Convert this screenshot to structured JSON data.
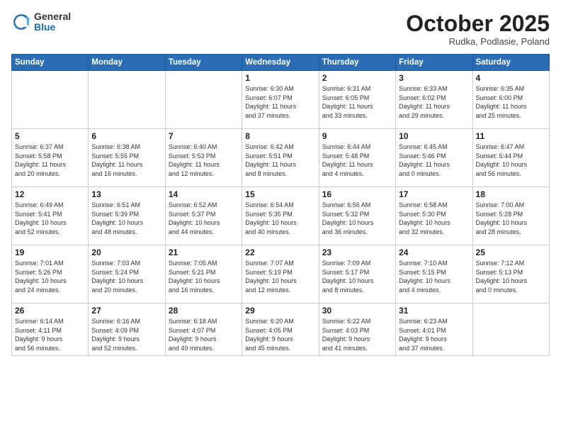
{
  "header": {
    "logo": {
      "general": "General",
      "blue": "Blue"
    },
    "title": "October 2025",
    "subtitle": "Rudka, Podlasie, Poland"
  },
  "weekdays": [
    "Sunday",
    "Monday",
    "Tuesday",
    "Wednesday",
    "Thursday",
    "Friday",
    "Saturday"
  ],
  "weeks": [
    [
      {
        "day": "",
        "info": ""
      },
      {
        "day": "",
        "info": ""
      },
      {
        "day": "",
        "info": ""
      },
      {
        "day": "1",
        "info": "Sunrise: 6:30 AM\nSunset: 6:07 PM\nDaylight: 11 hours\nand 37 minutes."
      },
      {
        "day": "2",
        "info": "Sunrise: 6:31 AM\nSunset: 6:05 PM\nDaylight: 11 hours\nand 33 minutes."
      },
      {
        "day": "3",
        "info": "Sunrise: 6:33 AM\nSunset: 6:02 PM\nDaylight: 11 hours\nand 29 minutes."
      },
      {
        "day": "4",
        "info": "Sunrise: 6:35 AM\nSunset: 6:00 PM\nDaylight: 11 hours\nand 25 minutes."
      }
    ],
    [
      {
        "day": "5",
        "info": "Sunrise: 6:37 AM\nSunset: 5:58 PM\nDaylight: 11 hours\nand 20 minutes."
      },
      {
        "day": "6",
        "info": "Sunrise: 6:38 AM\nSunset: 5:55 PM\nDaylight: 11 hours\nand 16 minutes."
      },
      {
        "day": "7",
        "info": "Sunrise: 6:40 AM\nSunset: 5:53 PM\nDaylight: 11 hours\nand 12 minutes."
      },
      {
        "day": "8",
        "info": "Sunrise: 6:42 AM\nSunset: 5:51 PM\nDaylight: 11 hours\nand 8 minutes."
      },
      {
        "day": "9",
        "info": "Sunrise: 6:44 AM\nSunset: 5:48 PM\nDaylight: 11 hours\nand 4 minutes."
      },
      {
        "day": "10",
        "info": "Sunrise: 6:45 AM\nSunset: 5:46 PM\nDaylight: 11 hours\nand 0 minutes."
      },
      {
        "day": "11",
        "info": "Sunrise: 6:47 AM\nSunset: 5:44 PM\nDaylight: 10 hours\nand 56 minutes."
      }
    ],
    [
      {
        "day": "12",
        "info": "Sunrise: 6:49 AM\nSunset: 5:41 PM\nDaylight: 10 hours\nand 52 minutes."
      },
      {
        "day": "13",
        "info": "Sunrise: 6:51 AM\nSunset: 5:39 PM\nDaylight: 10 hours\nand 48 minutes."
      },
      {
        "day": "14",
        "info": "Sunrise: 6:52 AM\nSunset: 5:37 PM\nDaylight: 10 hours\nand 44 minutes."
      },
      {
        "day": "15",
        "info": "Sunrise: 6:54 AM\nSunset: 5:35 PM\nDaylight: 10 hours\nand 40 minutes."
      },
      {
        "day": "16",
        "info": "Sunrise: 6:56 AM\nSunset: 5:32 PM\nDaylight: 10 hours\nand 36 minutes."
      },
      {
        "day": "17",
        "info": "Sunrise: 6:58 AM\nSunset: 5:30 PM\nDaylight: 10 hours\nand 32 minutes."
      },
      {
        "day": "18",
        "info": "Sunrise: 7:00 AM\nSunset: 5:28 PM\nDaylight: 10 hours\nand 28 minutes."
      }
    ],
    [
      {
        "day": "19",
        "info": "Sunrise: 7:01 AM\nSunset: 5:26 PM\nDaylight: 10 hours\nand 24 minutes."
      },
      {
        "day": "20",
        "info": "Sunrise: 7:03 AM\nSunset: 5:24 PM\nDaylight: 10 hours\nand 20 minutes."
      },
      {
        "day": "21",
        "info": "Sunrise: 7:05 AM\nSunset: 5:21 PM\nDaylight: 10 hours\nand 16 minutes."
      },
      {
        "day": "22",
        "info": "Sunrise: 7:07 AM\nSunset: 5:19 PM\nDaylight: 10 hours\nand 12 minutes."
      },
      {
        "day": "23",
        "info": "Sunrise: 7:09 AM\nSunset: 5:17 PM\nDaylight: 10 hours\nand 8 minutes."
      },
      {
        "day": "24",
        "info": "Sunrise: 7:10 AM\nSunset: 5:15 PM\nDaylight: 10 hours\nand 4 minutes."
      },
      {
        "day": "25",
        "info": "Sunrise: 7:12 AM\nSunset: 5:13 PM\nDaylight: 10 hours\nand 0 minutes."
      }
    ],
    [
      {
        "day": "26",
        "info": "Sunrise: 6:14 AM\nSunset: 4:11 PM\nDaylight: 9 hours\nand 56 minutes."
      },
      {
        "day": "27",
        "info": "Sunrise: 6:16 AM\nSunset: 4:09 PM\nDaylight: 9 hours\nand 52 minutes."
      },
      {
        "day": "28",
        "info": "Sunrise: 6:18 AM\nSunset: 4:07 PM\nDaylight: 9 hours\nand 49 minutes."
      },
      {
        "day": "29",
        "info": "Sunrise: 6:20 AM\nSunset: 4:05 PM\nDaylight: 9 hours\nand 45 minutes."
      },
      {
        "day": "30",
        "info": "Sunrise: 6:22 AM\nSunset: 4:03 PM\nDaylight: 9 hours\nand 41 minutes."
      },
      {
        "day": "31",
        "info": "Sunrise: 6:23 AM\nSunset: 4:01 PM\nDaylight: 9 hours\nand 37 minutes."
      },
      {
        "day": "",
        "info": ""
      }
    ]
  ]
}
